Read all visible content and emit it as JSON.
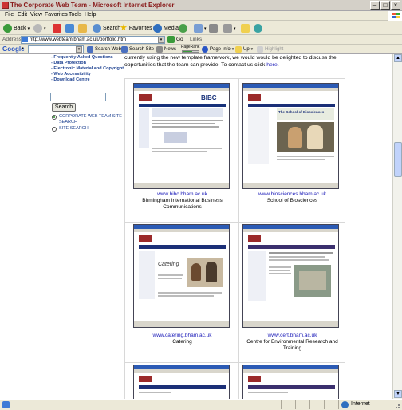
{
  "window": {
    "title": "The  Corporate Web Team - Microsoft Internet Explorer"
  },
  "menu": [
    "File",
    "Edit",
    "View",
    "Favorites",
    "Tools",
    "Help"
  ],
  "toolbar": {
    "back": "Back",
    "search": "Search",
    "favorites": "Favorites",
    "media": "Media"
  },
  "address": {
    "label": "Address",
    "url": "http://www.webteam.bham.ac.uk/portfolio.htm",
    "go": "Go",
    "links": "Links"
  },
  "google": {
    "label": "Google",
    "search_web": "Search Web",
    "search_site": "Search Site",
    "news": "News",
    "pagerank": "PageRank",
    "page_info": "Page Info",
    "up": "Up",
    "highlight": "Highlight"
  },
  "sidebar": {
    "links": [
      "Frequently Asked Questions",
      "Data Protection",
      "Electronic Material and Copyright",
      "Web Accessibility",
      "Download Centre"
    ],
    "search_button": "Search",
    "radio_corporate": "CORPORATE WEB TEAM SITE SEARCH",
    "radio_site": "SITE SEARCH"
  },
  "intro": {
    "line1": "currently using the new template framework, we would would be delighted to discuss the",
    "line2": "opportunities that the team can provide. To contact us click ",
    "link": "here",
    "period": "."
  },
  "portfolio": [
    {
      "url": "www.bibc.bham.ac.uk",
      "name_line1": "Birmingham International Business",
      "name_line2": "Communications"
    },
    {
      "url": "www.biosciences.bham.ac.uk",
      "name_line1": "School of Biosciences",
      "name_line2": ""
    },
    {
      "url": "www.catering.bham.ac.uk",
      "name_line1": "Catering",
      "name_line2": ""
    },
    {
      "url": "www.cert.bham.ac.uk",
      "name_line1": "Centre for Environmental Research and",
      "name_line2": "Training"
    }
  ],
  "shots": {
    "bibc_heading": "BIBC",
    "bio_heading": "The School of Biosciences",
    "catering_heading": "Catering"
  },
  "status": {
    "zone": "Internet"
  }
}
